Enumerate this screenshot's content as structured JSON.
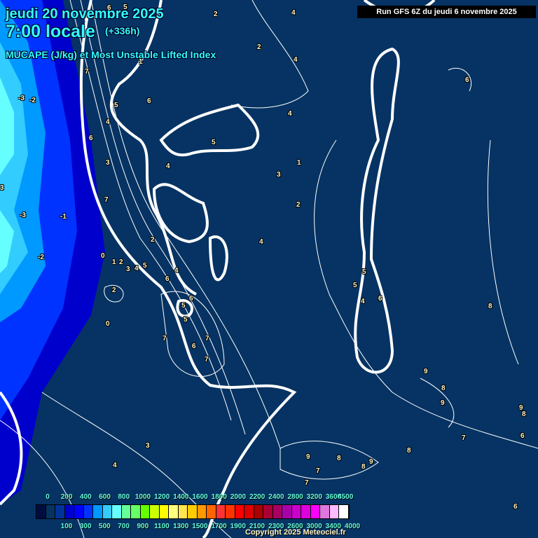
{
  "header": {
    "date": "jeudi 20 novembre 2025",
    "time": "7:00 locale",
    "lead": "(+336h)",
    "parameter": "MUCAPE (J/kg) et Most Unstable Lifted Index",
    "run": "Run GFS 6Z du jeudi 6 novembre 2025"
  },
  "contour_labels": [
    "6",
    "5",
    "2",
    "4",
    "2",
    "4",
    "7",
    "6",
    "5",
    "4",
    "4",
    "6",
    "3",
    "4",
    "7",
    "5",
    "-3",
    "-2",
    "3",
    "-3",
    "-1",
    "-2",
    "0",
    "1",
    "2",
    "3",
    "4",
    "5",
    "2",
    "0",
    "4",
    "1",
    "3",
    "2",
    "4",
    "6",
    "4",
    "5",
    "5",
    "6",
    "5",
    "6",
    "7",
    "6",
    "7",
    "7",
    "1",
    "9",
    "8",
    "9",
    "8",
    "9",
    "9",
    "8",
    "7",
    "8",
    "7",
    "8",
    "9",
    "6",
    "7",
    "3",
    "4",
    "6",
    "6",
    "8",
    "5",
    "2"
  ],
  "legend": {
    "top_labels": [
      "0",
      "200",
      "400",
      "600",
      "800",
      "1000",
      "1200",
      "1400",
      "1600",
      "1800",
      "2000",
      "2200",
      "2400",
      "2800",
      "3200",
      "3600",
      "4500"
    ],
    "bottom_labels": [
      "100",
      "300",
      "500",
      "700",
      "900",
      "1100",
      "1300",
      "1500",
      "1700",
      "1900",
      "2100",
      "2300",
      "2600",
      "3000",
      "3400",
      "4000"
    ],
    "colors": [
      "#000d40",
      "#06335f",
      "#003399",
      "#0000cc",
      "#0000ff",
      "#0033ff",
      "#0099ff",
      "#33ccff",
      "#66ffff",
      "#66ff99",
      "#66ff66",
      "#66ff00",
      "#ccff00",
      "#ffff00",
      "#ffff80",
      "#ffe650",
      "#ffcc00",
      "#ff9900",
      "#ff6600",
      "#ff3333",
      "#ff3300",
      "#ff0000",
      "#dd0000",
      "#aa0000",
      "#aa0033",
      "#aa0066",
      "#aa00aa",
      "#cc00cc",
      "#dd00dd",
      "#ff00ff",
      "#dd77dd",
      "#ffbbff",
      "#ffffff"
    ]
  },
  "copyright": "Copyright 2025 Meteociel.fr"
}
